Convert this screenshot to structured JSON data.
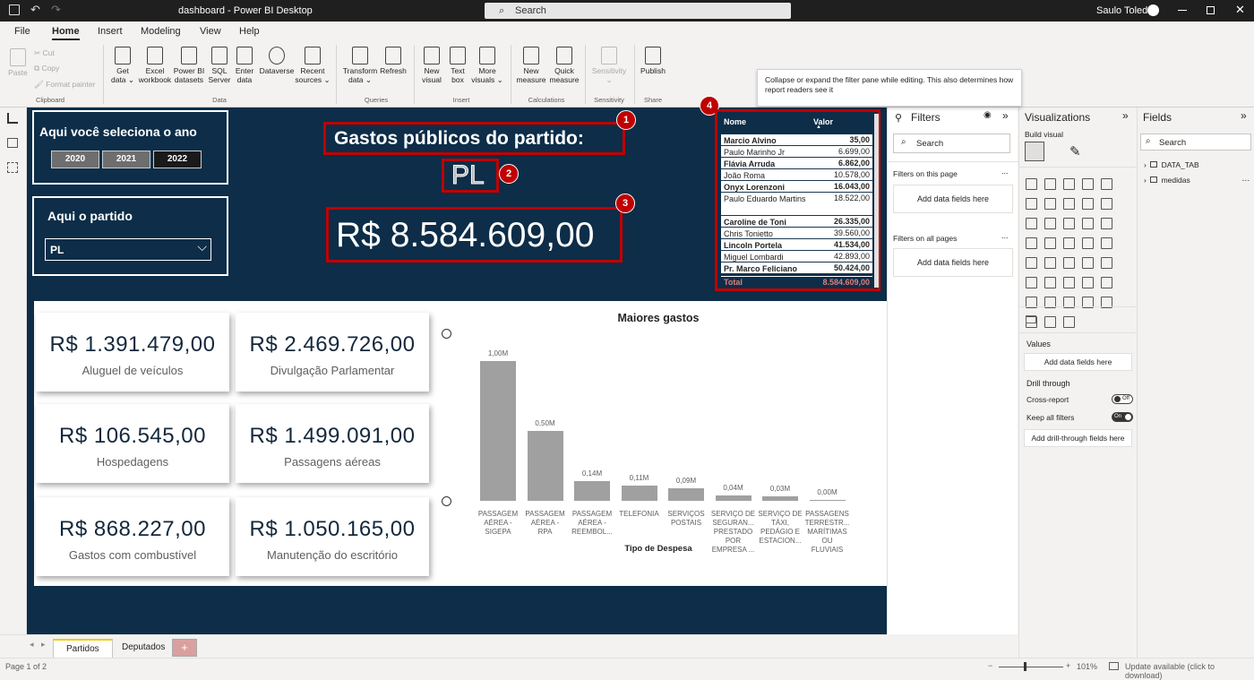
{
  "titlebar": {
    "doc_title": "dashboard - Power BI Desktop",
    "search_placeholder": "Search",
    "user": "Saulo Toledo"
  },
  "menu": [
    "File",
    "Home",
    "Insert",
    "Modeling",
    "View",
    "Help"
  ],
  "ribbon": {
    "clipboard": {
      "paste": "Paste",
      "cut": "Cut",
      "copy": "Copy",
      "format_painter": "Format painter",
      "group": "Clipboard"
    },
    "data": {
      "get_data": "Get data ⌄",
      "excel": "Excel workbook",
      "pbi": "Power BI datasets",
      "sql": "SQL Server",
      "enter": "Enter data",
      "dataverse": "Dataverse",
      "recent": "Recent sources ⌄",
      "group": "Data"
    },
    "queries": {
      "transform": "Transform data ⌄",
      "refresh": "Refresh",
      "group": "Queries"
    },
    "insert": {
      "new_visual": "New visual",
      "text_box": "Text box",
      "more": "More visuals ⌄",
      "group": "Insert"
    },
    "calc": {
      "new_measure": "New measure",
      "quick_measure": "Quick measure",
      "group": "Calculations"
    },
    "sens": {
      "sensitivity": "Sensitivity ⌄",
      "group": "Sensitivity"
    },
    "share": {
      "publish": "Publish",
      "group": "Share"
    }
  },
  "tooltip": "Collapse or expand the filter pane while editing. This also determines how report readers see it",
  "report": {
    "year_title": "Aqui você seleciona o ano",
    "years": [
      "2020",
      "2021",
      "2022"
    ],
    "party_title": "Aqui o partido",
    "party_selected": "PL",
    "main_title": "Gastos públicos do partido:",
    "party_big": "PL",
    "total": "R$ 8.584.609,00",
    "badges": [
      "1",
      "2",
      "3",
      "4"
    ],
    "table": {
      "col_name": "Nome",
      "col_value": "Valor",
      "rows": [
        {
          "name": "Marcio Alvino",
          "value": "35,00",
          "bold": true
        },
        {
          "name": "Paulo Marinho Jr",
          "value": "6.699,00",
          "bold": false
        },
        {
          "name": "Flávia Arruda",
          "value": "6.862,00",
          "bold": true
        },
        {
          "name": "João Roma",
          "value": "10.578,00",
          "bold": false
        },
        {
          "name": "Onyx Lorenzoni",
          "value": "16.043,00",
          "bold": true
        },
        {
          "name": "Paulo Eduardo Martins",
          "value": "18.522,00",
          "bold": false
        },
        {
          "name": "Caroline de Toni",
          "value": "26.335,00",
          "bold": true
        },
        {
          "name": "Chris Tonietto",
          "value": "39.560,00",
          "bold": false
        },
        {
          "name": "Lincoln Portela",
          "value": "41.534,00",
          "bold": true
        },
        {
          "name": "Miguel Lombardi",
          "value": "42.893,00",
          "bold": false
        },
        {
          "name": "Pr. Marco Feliciano",
          "value": "50.424,00",
          "bold": true
        }
      ],
      "total_label": "Total",
      "total_value": "8.584.609,00"
    },
    "cards": [
      {
        "value": "R$ 1.391.479,00",
        "label": "Aluguel de veículos"
      },
      {
        "value": "R$ 2.469.726,00",
        "label": "Divulgação Parlamentar"
      },
      {
        "value": "R$ 106.545,00",
        "label": "Hospedagens"
      },
      {
        "value": "R$ 1.499.091,00",
        "label": "Passagens aéreas"
      },
      {
        "value": "R$ 868.227,00",
        "label": "Gastos com combustível"
      },
      {
        "value": "R$ 1.050.165,00",
        "label": "Manutenção do escritório"
      }
    ]
  },
  "chart_data": {
    "type": "bar",
    "title": "Maiores gastos",
    "xlabel": "Tipo de Despesa",
    "ylabel": "",
    "categories": [
      [
        "PASSAGEM",
        "AÉREA -",
        "SIGEPA"
      ],
      [
        "PASSAGEM",
        "AÉREA -",
        "RPA"
      ],
      [
        "PASSAGEM",
        "AÉREA -",
        "REEMBOL..."
      ],
      [
        "TELEFONIA"
      ],
      [
        "SERVIÇOS",
        "POSTAIS"
      ],
      [
        "SERVIÇO DE",
        "SEGURAN...",
        "PRESTADO",
        "POR",
        "EMPRESA ..."
      ],
      [
        "SERVIÇO DE",
        "TÁXI,",
        "PEDÁGIO E",
        "ESTACION..."
      ],
      [
        "PASSAGENS",
        "TERRESTR...",
        "MARÍTIMAS",
        "OU",
        "FLUVIAIS"
      ]
    ],
    "values": [
      1.0,
      0.5,
      0.14,
      0.11,
      0.09,
      0.04,
      0.03,
      0.0
    ],
    "labels": [
      "1,00M",
      "0,50M",
      "0,14M",
      "0,11M",
      "0,09M",
      "0,04M",
      "0,03M",
      "0,00M"
    ],
    "ylim": [
      0,
      1.0
    ],
    "grid": false,
    "bar_color": "#a0a0a0"
  },
  "filters": {
    "title": "Filters",
    "search_placeholder": "Search",
    "on_page": "Filters on this page",
    "on_all": "Filters on all pages",
    "add": "Add data fields here",
    "more": "..."
  },
  "viz": {
    "title": "Visualizations",
    "build": "Build visual",
    "values": "Values",
    "add": "Add data fields here",
    "drill": "Drill through",
    "cross": "Cross-report",
    "keep": "Keep all filters",
    "add_drill": "Add drill-through fields here",
    "toggle_off": "Off",
    "toggle_on": "On"
  },
  "fields": {
    "title": "Fields",
    "search_placeholder": "Search",
    "items": [
      "DATA_TAB",
      "medidas"
    ]
  },
  "tabs": [
    "Partidos",
    "Deputados"
  ],
  "status": {
    "page": "Page 1 of 2",
    "zoom": "101%",
    "update": "Update available (click to download)"
  },
  "colors": {
    "report_bg": "#0d2d48",
    "accent_red": "#c00000",
    "ribbon_bg": "#f3f2f1"
  }
}
